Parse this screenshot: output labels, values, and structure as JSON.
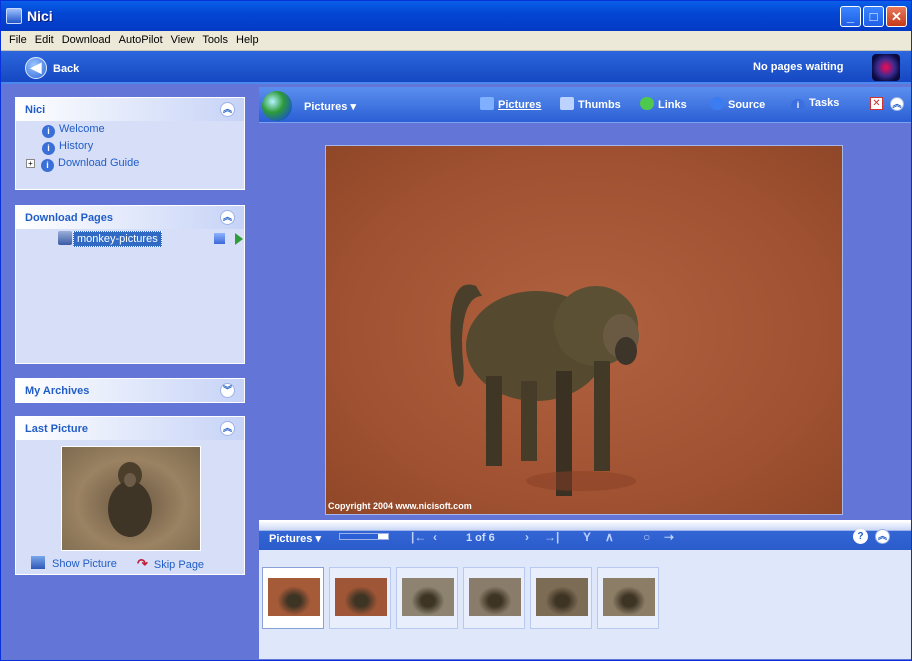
{
  "window": {
    "title": "Nici"
  },
  "menu": [
    "File",
    "Edit",
    "Download",
    "AutoPilot",
    "View",
    "Tools",
    "Help"
  ],
  "nav": {
    "back_label": "Back",
    "status": "No pages waiting"
  },
  "panels": {
    "nici": {
      "title": "Nici",
      "links": [
        "Welcome",
        "History",
        "Download Guide"
      ]
    },
    "download_pages": {
      "title": "Download Pages",
      "item": "monkey-pictures"
    },
    "my_archives": {
      "title": "My Archives"
    },
    "last_picture": {
      "title": "Last Picture",
      "show": "Show Picture",
      "skip": "Skip Page"
    }
  },
  "main": {
    "view_label": "Pictures",
    "tabs": [
      "Pictures",
      "Thumbs",
      "Links",
      "Source",
      "Tasks"
    ],
    "copyright": "Copyright 2004 www.nicisoft.com"
  },
  "strip": {
    "label": "Pictures",
    "counter": "1 of 6",
    "progress": 0.8,
    "thumb_count": 6
  }
}
